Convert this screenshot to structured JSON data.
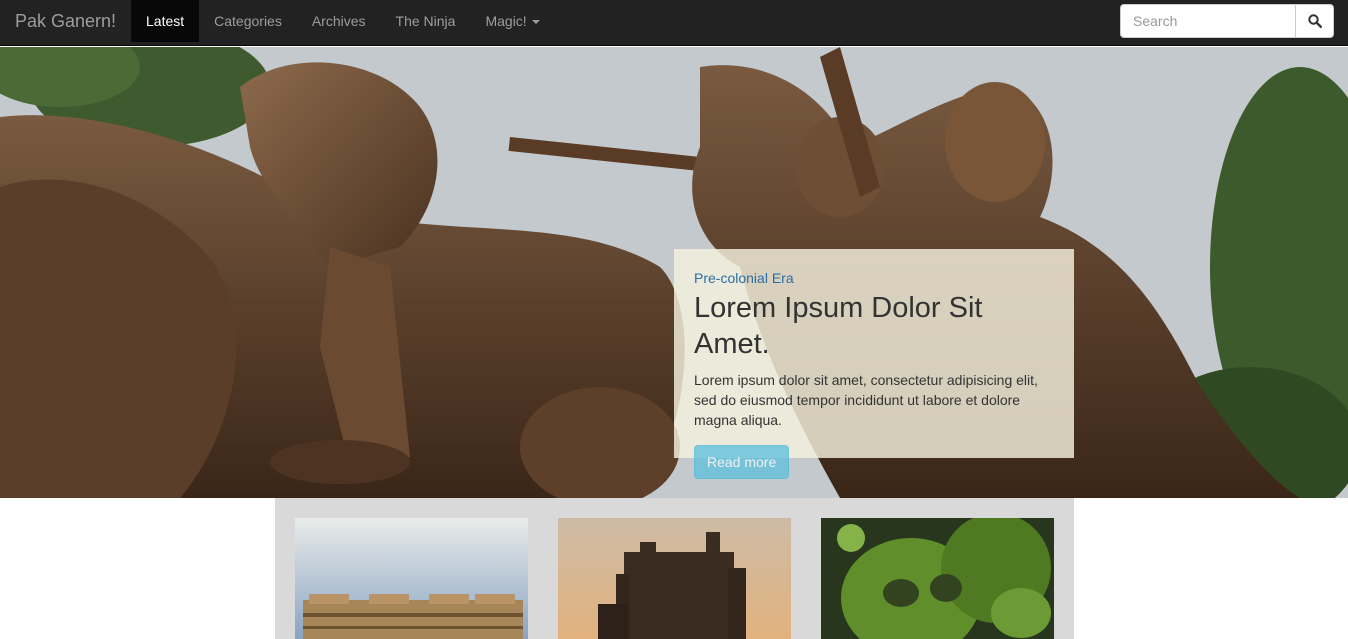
{
  "navbar": {
    "brand": "Pak Ganern!",
    "items": [
      {
        "label": "Latest",
        "active": true
      },
      {
        "label": "Categories"
      },
      {
        "label": "Archives"
      },
      {
        "label": "The Ninja"
      },
      {
        "label": "Magic!",
        "dropdown": true
      }
    ],
    "search": {
      "placeholder": "Search",
      "button_icon": "search-icon"
    }
  },
  "hero": {
    "image": "bronze-statue-monument",
    "caption": {
      "category": "Pre-colonial Era",
      "title": "Lorem Ipsum Dolor Sit Amet.",
      "text": "Lorem ipsum dolor sit amet, consectetur adipisicing elit, sed do eiusmod tempor incididunt ut labore et dolore magna aliqua.",
      "button": "Read more"
    }
  },
  "gallery": {
    "items": [
      {
        "image": "ornate-temple-facade"
      },
      {
        "image": "stone-castle-sunset"
      },
      {
        "image": "moss-covered-statue"
      }
    ]
  },
  "colors": {
    "navbar_bg": "#222222",
    "caption_bg": "#f5f1de",
    "category_link": "#2a6ea6",
    "button_info": "#5bc0de",
    "gallery_bg": "#d9d9d9"
  }
}
